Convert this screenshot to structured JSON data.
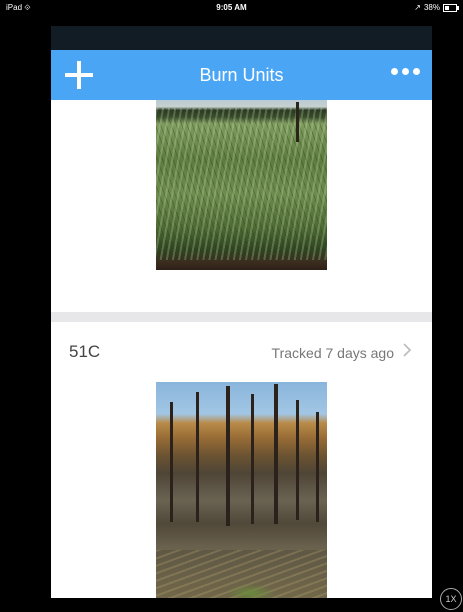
{
  "status_bar": {
    "device": "iPad",
    "wifi": "⟐",
    "time": "9:05 AM",
    "battery_text": "38%",
    "location": "↗"
  },
  "nav": {
    "title": "Burn Units",
    "add_icon": "plus-icon",
    "more_icon": "more-dots-icon",
    "color": "#4aa6f5"
  },
  "units": [
    {
      "name": "",
      "tracked": "",
      "photo": "grass field"
    },
    {
      "name": "51C",
      "tracked": "Tracked 7 days ago",
      "photo": "burned forest"
    }
  ],
  "zoom_label": "1X"
}
